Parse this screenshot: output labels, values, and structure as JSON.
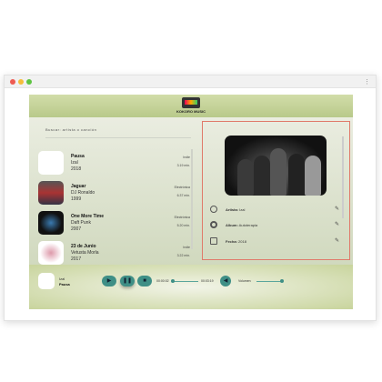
{
  "header": {
    "logo_text": "KOKORO MUSIC"
  },
  "search": {
    "placeholder": "Buscar: artista o canción"
  },
  "songs": [
    {
      "title": "Pausa",
      "artist": "Izal",
      "year": "2018",
      "genre": "Indie",
      "duration": "3.19 min."
    },
    {
      "title": "Jaguar",
      "artist": "DJ Ronaldo",
      "year": "1999",
      "genre": "Electrónica",
      "duration": "6.37 min."
    },
    {
      "title": "One More Time",
      "artist": "Daft Punk",
      "year": "2007",
      "genre": "Electrónica",
      "duration": "5.20 min."
    },
    {
      "title": "23 de Junio",
      "artist": "Vetusta Morla",
      "year": "2017",
      "genre": "Indie",
      "duration": "3.22 min."
    }
  ],
  "details": {
    "artist_label": "Artista:",
    "artist": "Izal",
    "album_label": "Album:",
    "album": "Autoterapia",
    "date_label": "Fecha:",
    "date": "2018"
  },
  "player": {
    "artist": "Izal",
    "title": "Pausa",
    "elapsed": "00:00:02",
    "total": "00:03:19",
    "volume_label": "Volumen",
    "progress": 0.01,
    "volume": 1.0
  },
  "colors": {
    "accent": "#3f8f86",
    "highlight": "#e07a6a",
    "header": "#c2d194"
  }
}
